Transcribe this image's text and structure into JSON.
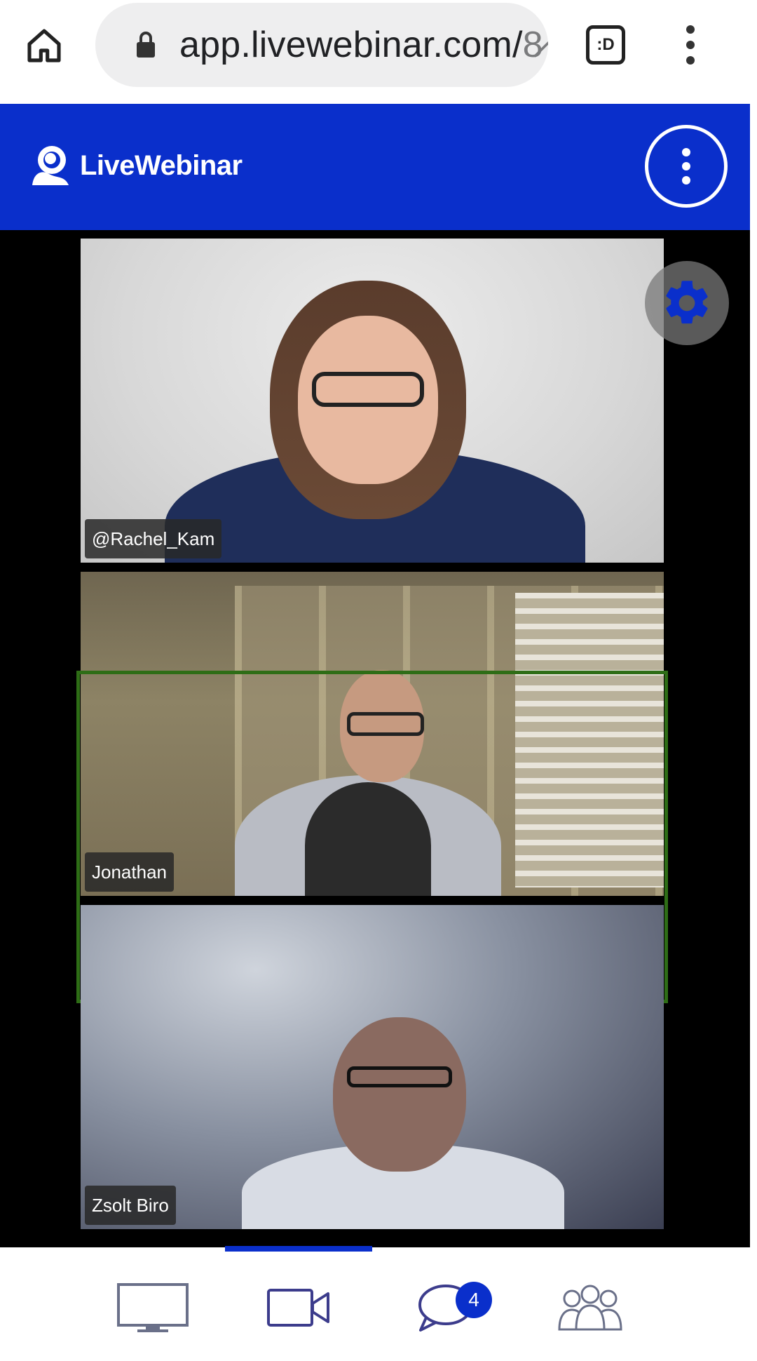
{
  "browser": {
    "url_main": "app.livewebinar.com/",
    "url_dim": "8̷",
    "tab_switcher_label": ":D"
  },
  "header": {
    "brand": "LiveWebinar"
  },
  "videos": [
    {
      "name": "@Rachel_Kam"
    },
    {
      "name": "Jonathan"
    },
    {
      "name": "Zsolt Biro",
      "active_speaker": true
    }
  ],
  "nav": {
    "items": [
      {
        "icon": "screen-icon"
      },
      {
        "icon": "video-camera-icon"
      },
      {
        "icon": "chat-icon",
        "badge": "4"
      },
      {
        "icon": "participants-icon"
      }
    ]
  },
  "colors": {
    "brand_blue": "#0a2fcb",
    "active_border": "#2e6d16",
    "nav_icon": "#3c3c8c"
  }
}
